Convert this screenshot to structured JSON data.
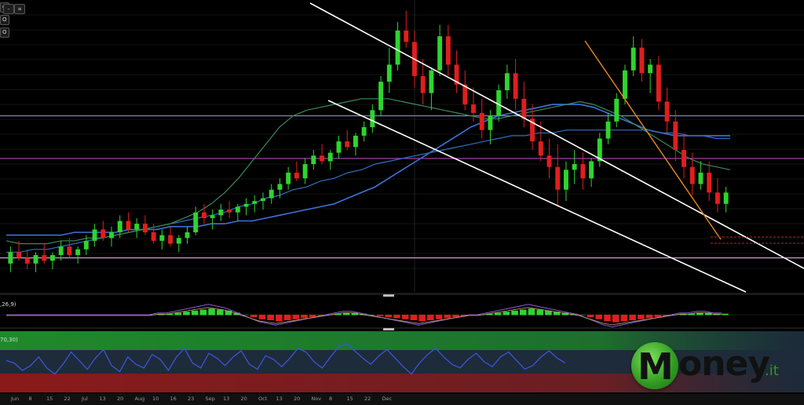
{
  "chart_data": {
    "type": "candlestick",
    "title": "",
    "x_tick_labels": [
      "Jun",
      "8",
      "15",
      "22",
      "Jul",
      "13",
      "20",
      "Aug",
      "10",
      "16",
      "23",
      "Sep",
      "13",
      "20",
      "Oct",
      "13",
      "20",
      "Nov",
      "8",
      "15",
      "22",
      "Dec"
    ],
    "ylim": [
      0,
      100
    ],
    "candles": [
      [
        10,
        16,
        7,
        14
      ],
      [
        14,
        18,
        11,
        12
      ],
      [
        12,
        15,
        8,
        10
      ],
      [
        10,
        14,
        7,
        13
      ],
      [
        13,
        17,
        10,
        11
      ],
      [
        11,
        14,
        8,
        13
      ],
      [
        13,
        18,
        11,
        16
      ],
      [
        16,
        19,
        12,
        13
      ],
      [
        13,
        16,
        10,
        15
      ],
      [
        15,
        20,
        13,
        18
      ],
      [
        18,
        24,
        16,
        22
      ],
      [
        22,
        25,
        18,
        19
      ],
      [
        19,
        23,
        16,
        21
      ],
      [
        21,
        27,
        19,
        25
      ],
      [
        25,
        28,
        21,
        22
      ],
      [
        22,
        26,
        19,
        24
      ],
      [
        24,
        27,
        20,
        21
      ],
      [
        21,
        24,
        17,
        18
      ],
      [
        18,
        22,
        15,
        20
      ],
      [
        20,
        23,
        16,
        17
      ],
      [
        17,
        20,
        14,
        19
      ],
      [
        19,
        23,
        17,
        21
      ],
      [
        21,
        30,
        20,
        28
      ],
      [
        28,
        31,
        24,
        26
      ],
      [
        26,
        29,
        22,
        27
      ],
      [
        27,
        31,
        25,
        29
      ],
      [
        29,
        32,
        26,
        28
      ],
      [
        28,
        31,
        25,
        30
      ],
      [
        30,
        33,
        27,
        31
      ],
      [
        31,
        34,
        28,
        32
      ],
      [
        32,
        35,
        29,
        33
      ],
      [
        33,
        38,
        31,
        36
      ],
      [
        36,
        40,
        33,
        38
      ],
      [
        38,
        44,
        36,
        42
      ],
      [
        42,
        46,
        39,
        40
      ],
      [
        40,
        47,
        38,
        45
      ],
      [
        45,
        50,
        43,
        48
      ],
      [
        48,
        52,
        45,
        46
      ],
      [
        46,
        50,
        43,
        49
      ],
      [
        49,
        55,
        47,
        53
      ],
      [
        53,
        57,
        50,
        51
      ],
      [
        51,
        56,
        48,
        55
      ],
      [
        55,
        60,
        53,
        58
      ],
      [
        58,
        66,
        56,
        64
      ],
      [
        64,
        76,
        62,
        74
      ],
      [
        74,
        86,
        70,
        80
      ],
      [
        80,
        95,
        78,
        92
      ],
      [
        92,
        99,
        86,
        88
      ],
      [
        88,
        92,
        72,
        76
      ],
      [
        76,
        82,
        66,
        70
      ],
      [
        70,
        79,
        64,
        78
      ],
      [
        78,
        94,
        76,
        90
      ],
      [
        90,
        94,
        76,
        80
      ],
      [
        80,
        85,
        70,
        73
      ],
      [
        73,
        78,
        64,
        66
      ],
      [
        66,
        72,
        60,
        63
      ],
      [
        63,
        68,
        54,
        57
      ],
      [
        57,
        64,
        52,
        62
      ],
      [
        62,
        73,
        60,
        71
      ],
      [
        71,
        80,
        68,
        77
      ],
      [
        77,
        82,
        64,
        68
      ],
      [
        68,
        74,
        58,
        61
      ],
      [
        61,
        66,
        50,
        53
      ],
      [
        53,
        60,
        46,
        48
      ],
      [
        48,
        54,
        40,
        44
      ],
      [
        44,
        52,
        30,
        36
      ],
      [
        36,
        46,
        32,
        43
      ],
      [
        43,
        50,
        38,
        45
      ],
      [
        45,
        49,
        36,
        40
      ],
      [
        40,
        47,
        37,
        46
      ],
      [
        46,
        56,
        44,
        54
      ],
      [
        54,
        63,
        52,
        60
      ],
      [
        60,
        70,
        58,
        68
      ],
      [
        68,
        80,
        66,
        78
      ],
      [
        78,
        90,
        76,
        86
      ],
      [
        86,
        89,
        74,
        77
      ],
      [
        77,
        82,
        70,
        80
      ],
      [
        80,
        83,
        64,
        67
      ],
      [
        67,
        72,
        56,
        60
      ],
      [
        60,
        64,
        46,
        50
      ],
      [
        50,
        56,
        40,
        44
      ],
      [
        44,
        49,
        34,
        38
      ],
      [
        38,
        46,
        36,
        42
      ],
      [
        42,
        46,
        32,
        35
      ],
      [
        35,
        40,
        28,
        31
      ],
      [
        31,
        37,
        28,
        35
      ]
    ],
    "moving_averages": [
      {
        "color": "#3f72d8",
        "values": [
          20,
          20,
          20,
          20,
          20,
          21,
          21,
          21,
          21,
          22,
          22,
          22,
          23,
          23,
          23,
          24,
          24,
          25,
          25,
          26,
          27,
          28,
          29,
          30,
          31,
          33,
          35,
          37,
          40,
          43,
          46,
          49,
          52,
          55,
          58,
          60,
          62,
          63,
          64,
          65,
          66,
          66,
          66,
          65,
          63,
          61,
          59,
          57,
          56,
          55,
          55,
          55,
          55,
          55
        ]
      },
      {
        "color": "#2e6fc4",
        "values": [
          14,
          14,
          15,
          15,
          16,
          17,
          18,
          19,
          20,
          21,
          22,
          23,
          24,
          25,
          26,
          27,
          28,
          30,
          31,
          33,
          34,
          36,
          37,
          39,
          40,
          42,
          43,
          45,
          46,
          47,
          48,
          49,
          50,
          51,
          52,
          53,
          54,
          55,
          55,
          56,
          56,
          57,
          57,
          57,
          57,
          57,
          57,
          57,
          56,
          56,
          55,
          55,
          54,
          54
        ]
      },
      {
        "color": "#3a8a5a",
        "values": [
          18,
          17,
          17,
          17,
          18,
          18,
          19,
          19,
          20,
          21,
          22,
          23,
          24,
          26,
          28,
          31,
          35,
          40,
          46,
          52,
          58,
          62,
          64,
          65,
          66,
          67,
          68,
          68,
          68,
          67,
          66,
          65,
          64,
          63,
          62,
          61,
          61,
          62,
          63,
          64,
          65,
          66,
          67,
          66,
          64,
          62,
          59,
          56,
          53,
          50,
          47,
          45,
          44,
          43
        ]
      }
    ],
    "macd_label": ",26,9)",
    "macd_histogram": [
      0,
      0,
      0,
      0,
      0,
      0,
      0,
      0,
      0,
      0,
      0,
      0,
      0,
      0,
      0,
      0,
      0,
      0,
      1,
      1,
      2,
      3,
      4,
      5,
      6,
      5,
      4,
      2,
      0,
      -2,
      -4,
      -5,
      -6,
      -5,
      -4,
      -3,
      -2,
      -1,
      0,
      1,
      2,
      2,
      1,
      0,
      -1,
      -2,
      -3,
      -4,
      -5,
      -6,
      -5,
      -4,
      -3,
      -2,
      -1,
      0,
      0,
      1,
      2,
      3,
      4,
      5,
      6,
      5,
      4,
      3,
      2,
      1,
      0,
      -2,
      -4,
      -6,
      -7,
      -6,
      -5,
      -4,
      -3,
      -2,
      -1,
      0,
      1,
      1,
      2,
      2,
      1,
      1
    ],
    "macd_line_color": "#8a5ad8",
    "signal_line_color": "#c8a06a",
    "rsi_label": "70,30)",
    "rsi_values": [
      52,
      48,
      36,
      44,
      58,
      40,
      30,
      46,
      66,
      52,
      38,
      56,
      70,
      44,
      34,
      58,
      46,
      40,
      62,
      54,
      36,
      58,
      72,
      48,
      40,
      64,
      56,
      44,
      58,
      68,
      46,
      38,
      60,
      54,
      42,
      56,
      72,
      66,
      50,
      40,
      58,
      74,
      80,
      68,
      56,
      46,
      60,
      70,
      56,
      42,
      30,
      48,
      62,
      72,
      58,
      46,
      40,
      54,
      64,
      50,
      42,
      58,
      66,
      52,
      38,
      44,
      58,
      68,
      56,
      48
    ],
    "rsi_color": "#3a55d8",
    "horizontal_lines": [
      {
        "level": 62,
        "color": "#8a8ad8"
      },
      {
        "level": 47,
        "color": "#a040a0"
      },
      {
        "level": 12,
        "color": "#e0a8e0"
      }
    ],
    "trendlines_color_main": "#ffffff",
    "trendline_color_orange": "#e88a20"
  },
  "toolbar": {
    "tags": [
      "O",
      "O",
      "O"
    ],
    "icon_names": [
      "minus-icon",
      "list-icon"
    ]
  },
  "brand": {
    "logo_letter": "M",
    "logo_word": "oney",
    "logo_tld": ".it",
    "accent": "#2e9a1f"
  },
  "colors": {
    "up": "#2fd42f",
    "down": "#e01e1e",
    "grid": "#4a4a4a",
    "rsi_top": "#1f8a2a",
    "rsi_bottom": "#8a1a1a"
  }
}
